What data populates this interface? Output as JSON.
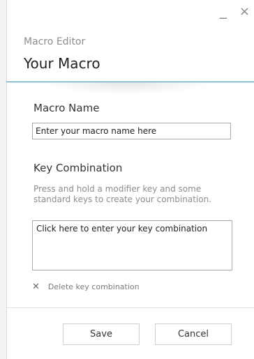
{
  "window": {
    "minimize_glyph": "_",
    "close_glyph": "×"
  },
  "header": {
    "subtitle": "Macro Editor",
    "title": "Your Macro"
  },
  "macro_name": {
    "label": "Macro Name",
    "value": "Enter your macro name here"
  },
  "key_combination": {
    "label": "Key Combination",
    "help_text": "Press and hold a modifier key and some standard keys to create your combination.",
    "box_text": "Click here to enter your key combination",
    "delete_label": "Delete key combination",
    "delete_icon_glyph": "✕"
  },
  "buttons": {
    "save": "Save",
    "cancel": "Cancel"
  },
  "colors": {
    "accent_line": "#3f95c6"
  }
}
